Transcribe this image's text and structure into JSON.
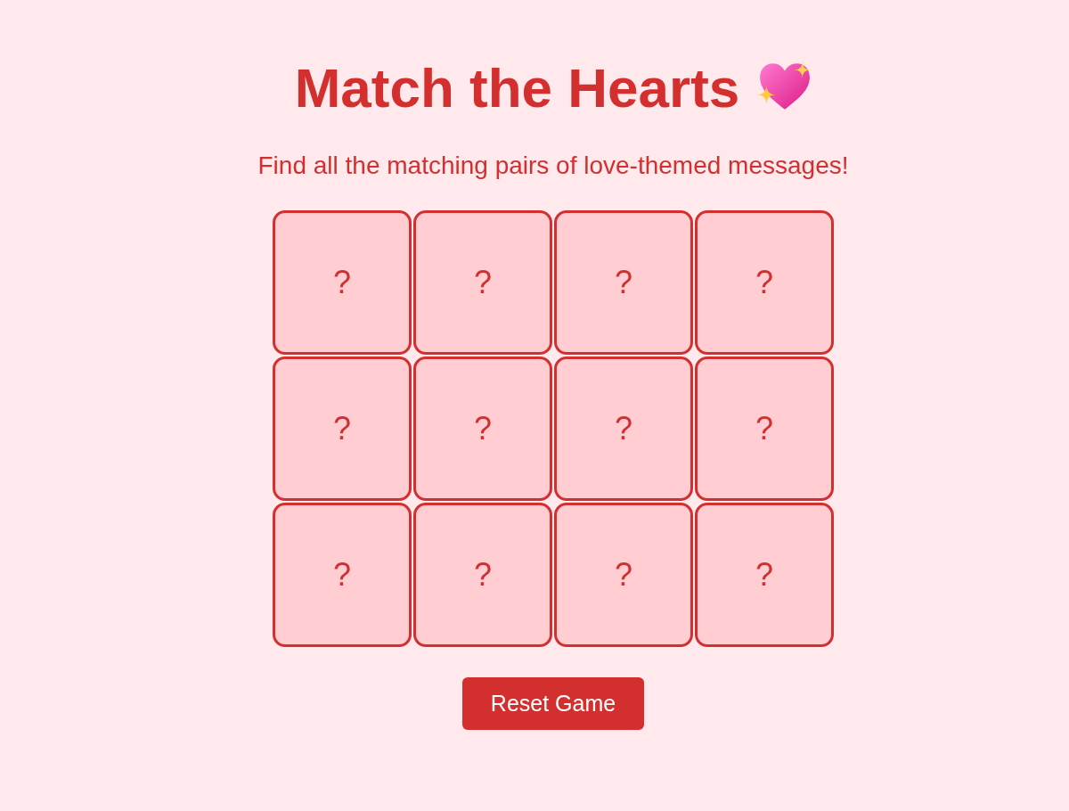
{
  "title": "Match the Hearts",
  "subtitle": "Find all the matching pairs of love-themed messages!",
  "cards": [
    {
      "label": "?"
    },
    {
      "label": "?"
    },
    {
      "label": "?"
    },
    {
      "label": "?"
    },
    {
      "label": "?"
    },
    {
      "label": "?"
    },
    {
      "label": "?"
    },
    {
      "label": "?"
    },
    {
      "label": "?"
    },
    {
      "label": "?"
    },
    {
      "label": "?"
    },
    {
      "label": "?"
    }
  ],
  "reset_button": "Reset Game"
}
